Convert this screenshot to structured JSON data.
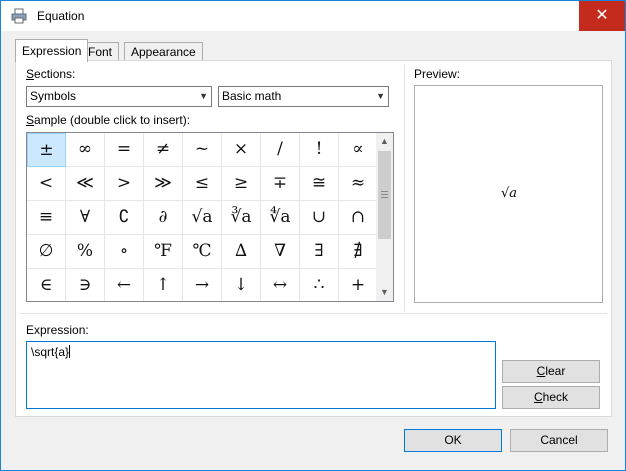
{
  "window": {
    "title": "Equation",
    "close_glyph": "✕"
  },
  "tabs": [
    {
      "label": "Expression",
      "active": true
    },
    {
      "label": "Font",
      "active": false
    },
    {
      "label": "Appearance",
      "active": false
    }
  ],
  "sections": {
    "label_accel": "S",
    "label_rest": "ections:",
    "primary_select": "Symbols",
    "secondary_select": "Basic math"
  },
  "sample": {
    "label_accel": "S",
    "label_rest": "ample (double click to insert):"
  },
  "symbols": [
    "±",
    "∞",
    "=",
    "≠",
    "~",
    "×",
    "/",
    "!",
    "∝",
    "<",
    "≪",
    ">",
    "≫",
    "≤",
    "≥",
    "∓",
    "≅",
    "≈",
    "≡",
    "∀",
    "∁",
    "∂",
    "√a",
    "∛a",
    "∜a",
    "∪",
    "∩",
    "∅",
    "%",
    "∘",
    "℉",
    "℃",
    "∆",
    "∇",
    "∃",
    "∄",
    "∈",
    "∋",
    "←",
    "↑",
    "→",
    "↓",
    "↔",
    "∴",
    "+"
  ],
  "preview": {
    "label": "Preview:",
    "content": "√a"
  },
  "expression": {
    "label": "Expression:",
    "value": "\\sqrt{a}"
  },
  "buttons": {
    "clear_accel": "C",
    "clear_rest": "lear",
    "check_accel": "C",
    "check_rest": "heck",
    "ok": "OK",
    "cancel": "Cancel"
  },
  "colors": {
    "selection": "#cce8ff",
    "close_red": "#c42b1c",
    "focus_blue": "#0078d7"
  }
}
